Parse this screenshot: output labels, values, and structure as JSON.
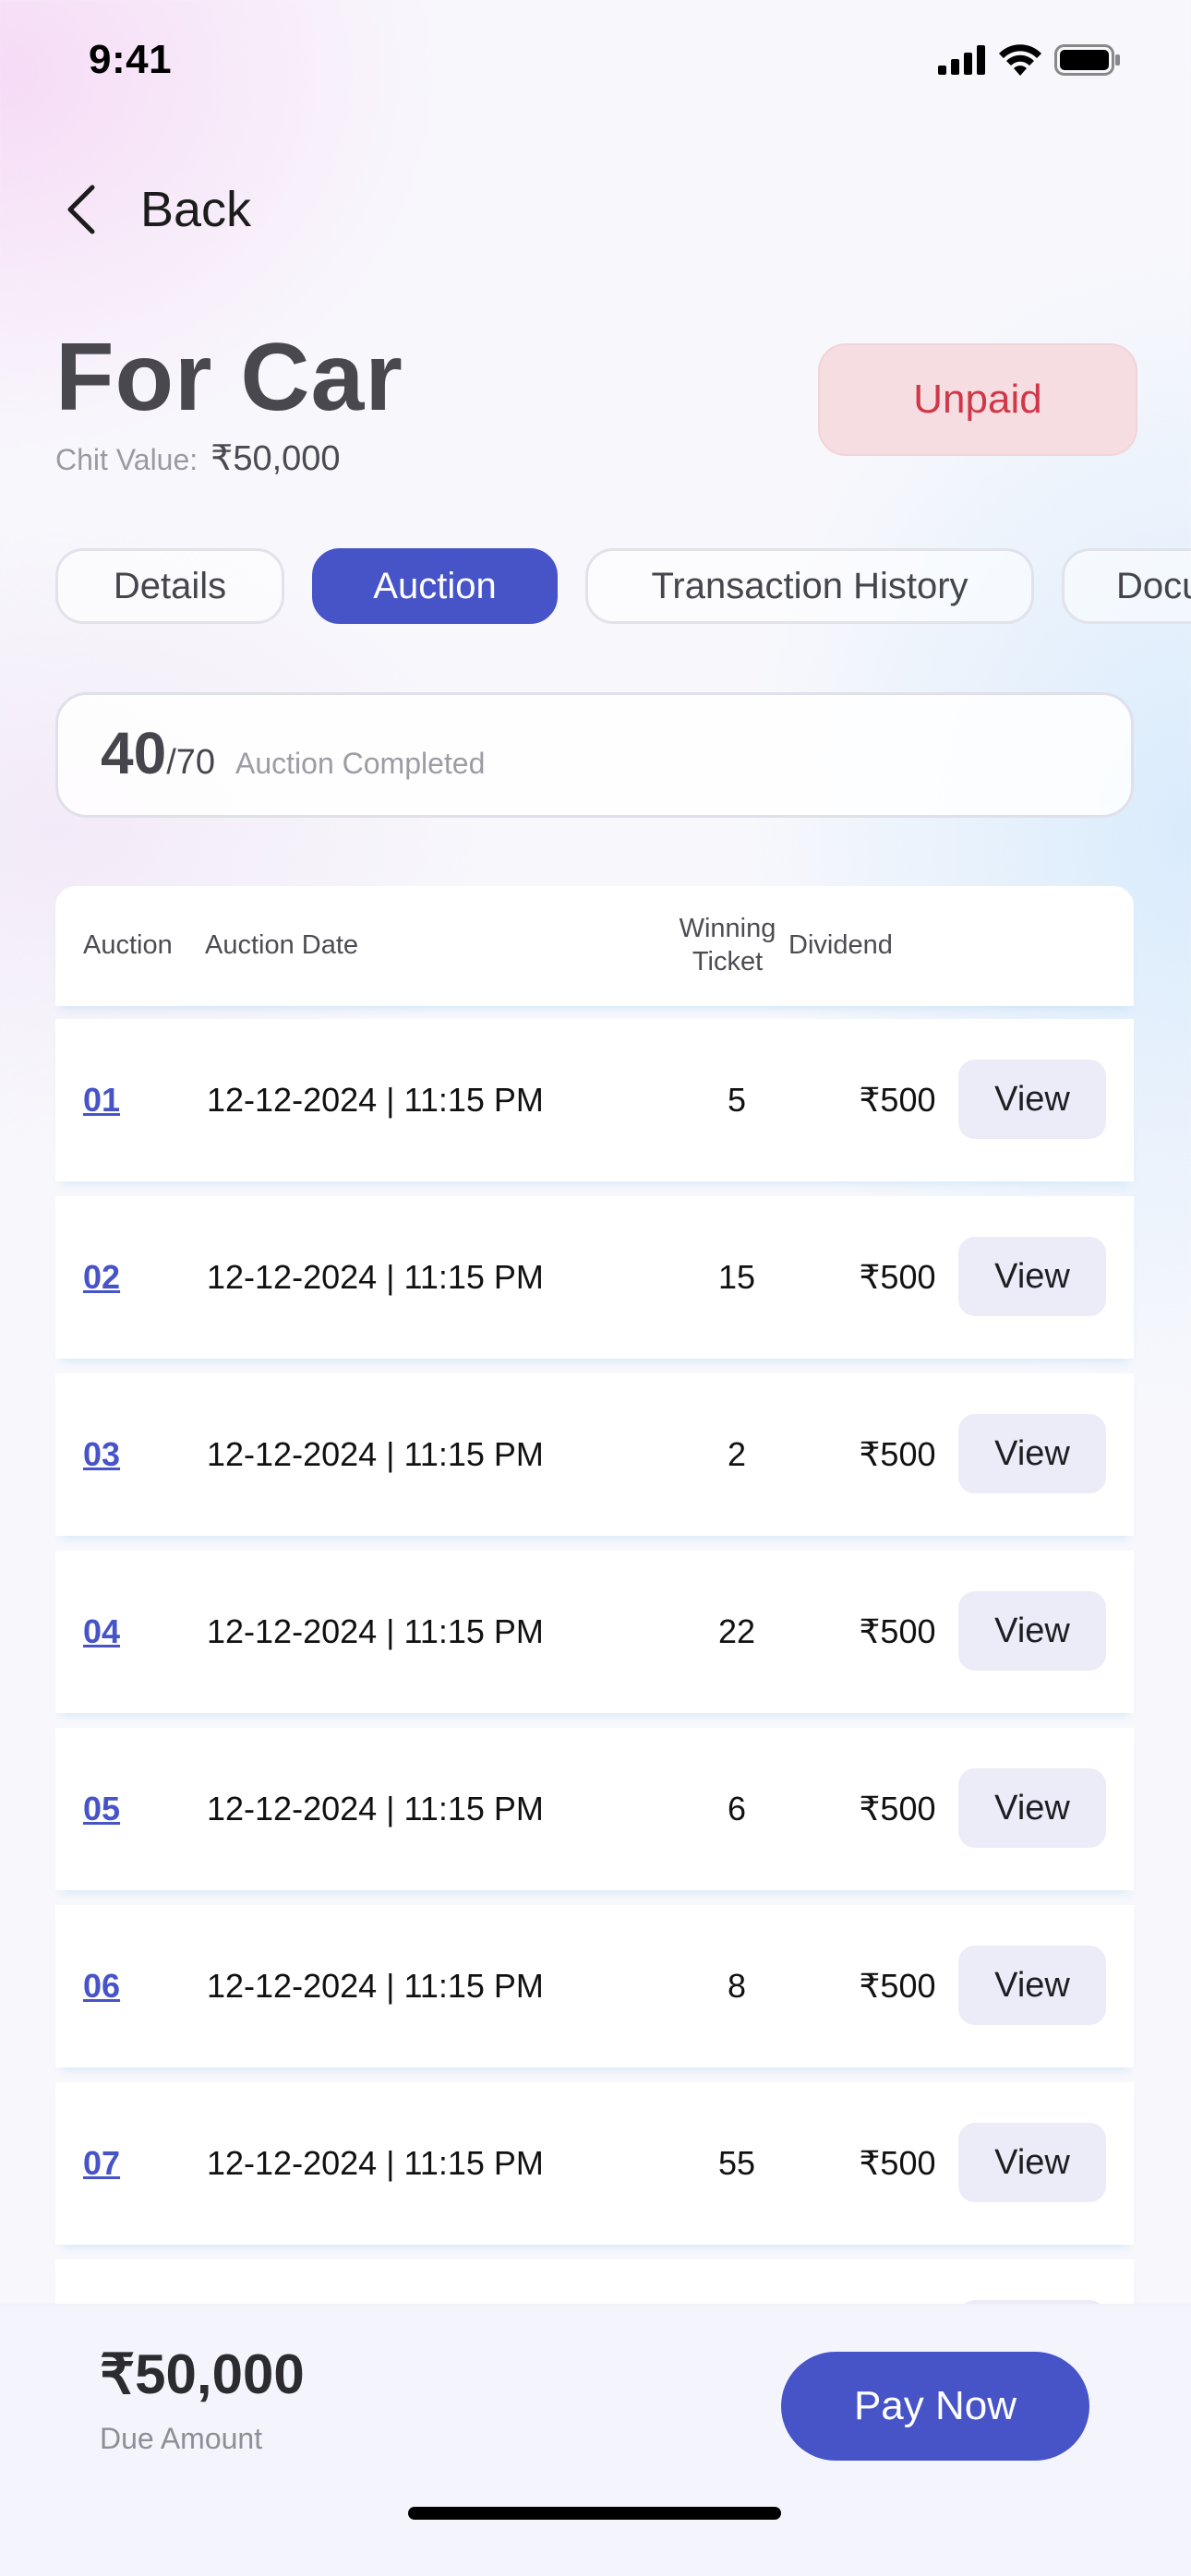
{
  "status_bar": {
    "time": "9:41"
  },
  "header": {
    "back_label": "Back"
  },
  "chit": {
    "title": "For Car",
    "value_label": "Chit Value:",
    "value": "₹50,000",
    "status": "Unpaid"
  },
  "tabs": [
    {
      "label": "Details",
      "active": false
    },
    {
      "label": "Auction",
      "active": true
    },
    {
      "label": "Transaction History",
      "active": false
    },
    {
      "label": "Documents",
      "active": false
    }
  ],
  "progress": {
    "completed": "40",
    "total": "/70",
    "label": "Auction Completed"
  },
  "table": {
    "headers": {
      "auction": "Auction",
      "date": "Auction Date",
      "winning_line1": "Winning",
      "winning_line2": "Ticket",
      "dividend": "Dividend"
    },
    "rows": [
      {
        "number": "01",
        "date": "12-12-2024 | 11:15 PM",
        "winning_ticket": "5",
        "dividend": "₹500",
        "action": "View"
      },
      {
        "number": "02",
        "date": "12-12-2024 | 11:15 PM",
        "winning_ticket": "15",
        "dividend": "₹500",
        "action": "View"
      },
      {
        "number": "03",
        "date": "12-12-2024 | 11:15 PM",
        "winning_ticket": "2",
        "dividend": "₹500",
        "action": "View"
      },
      {
        "number": "04",
        "date": "12-12-2024 | 11:15 PM",
        "winning_ticket": "22",
        "dividend": "₹500",
        "action": "View"
      },
      {
        "number": "05",
        "date": "12-12-2024 | 11:15 PM",
        "winning_ticket": "6",
        "dividend": "₹500",
        "action": "View"
      },
      {
        "number": "06",
        "date": "12-12-2024 | 11:15 PM",
        "winning_ticket": "8",
        "dividend": "₹500",
        "action": "View"
      },
      {
        "number": "07",
        "date": "12-12-2024 | 11:15 PM",
        "winning_ticket": "55",
        "dividend": "₹500",
        "action": "View"
      }
    ]
  },
  "footer": {
    "due_amount": "₹50,000",
    "due_label": "Due Amount",
    "pay_button": "Pay Now"
  },
  "colors": {
    "accent": "#4654c8",
    "unpaid_text": "#d03848",
    "unpaid_bg": "#f6dde1"
  }
}
